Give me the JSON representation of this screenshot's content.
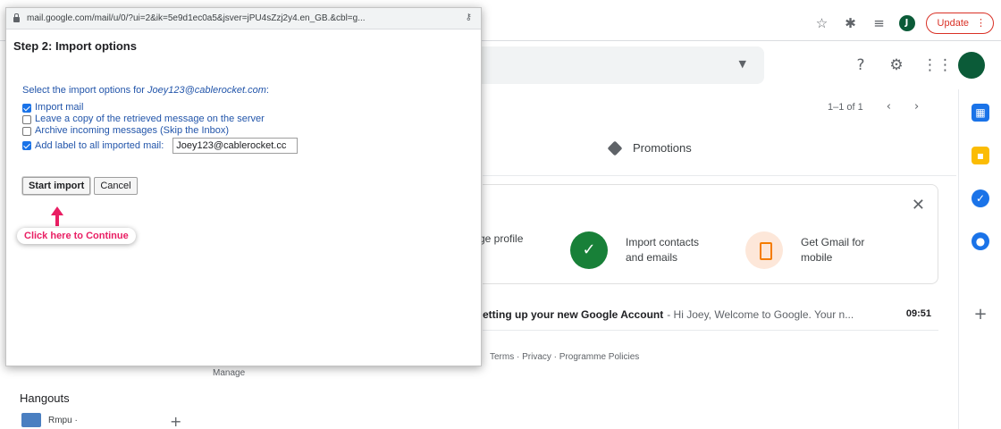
{
  "popup": {
    "url": "mail.google.com/mail/u/0/?ui=2&ik=5e9d1ec0a5&jsver=jPU4sZzj2y4.en_GB.&cbl=g...",
    "title": "Step 2: Import options",
    "instruction_prefix": "Select the import options for ",
    "account": "Joey123@cablerocket.com",
    "instruction_suffix": ":",
    "options": [
      {
        "label": "Import mail",
        "checked": true
      },
      {
        "label": "Leave a copy of the retrieved message on the server",
        "checked": false
      },
      {
        "label": "Archive incoming messages (Skip the Inbox)",
        "checked": false
      },
      {
        "label": "Add label to all imported mail:",
        "checked": true
      }
    ],
    "label_value": "Joey123@cablerocket.cc",
    "start_button": "Start import",
    "cancel_button": "Cancel",
    "hint": "Click here to Continue"
  },
  "browser": {
    "update_label": "Update",
    "menu_icon": "⋮",
    "icons": [
      "star-icon",
      "extensions-icon",
      "reading-list-icon",
      "profile-avatar",
      "update-button"
    ]
  },
  "gmail": {
    "pager": "1–1 of 1",
    "tab_promotions": "Promotions",
    "setup": {
      "profile": "ge profile",
      "contacts": "Import contacts\nand emails",
      "mobile": "Get Gmail for\nmobile"
    },
    "email": {
      "subject": "etting up your new Google Account",
      "snippet": " - Hi Joey, Welcome to Google. Your n...",
      "time": "09:51"
    },
    "footer": "Terms · Privacy · Programme Policies",
    "manage": "Manage",
    "hangouts_title": "Hangouts",
    "hangouts_user": "Rmpu ·"
  }
}
